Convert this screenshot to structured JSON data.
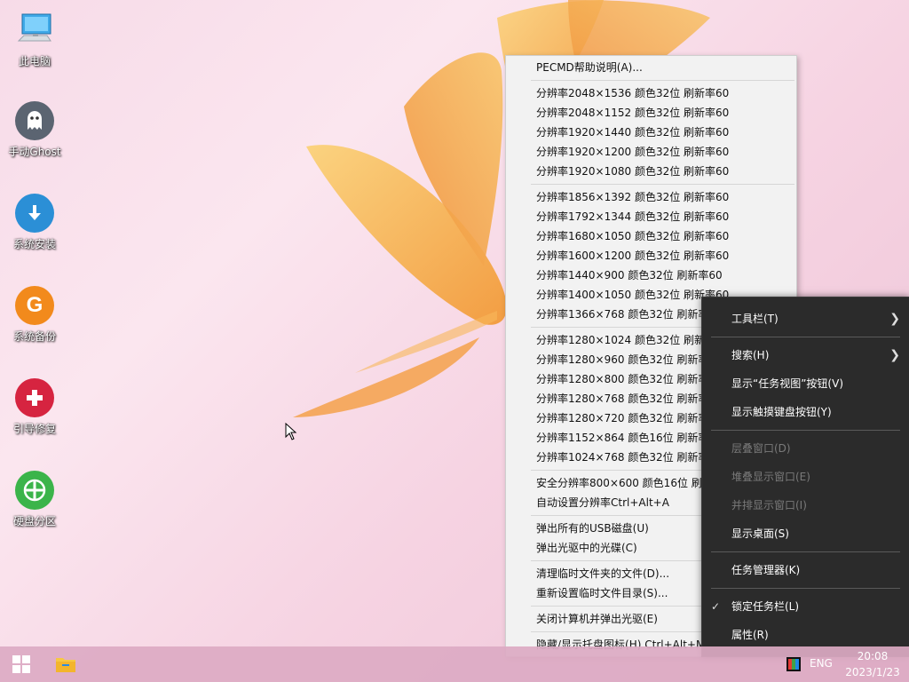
{
  "desktop_icons": [
    {
      "label": "此电脑",
      "icon": "computer-icon"
    },
    {
      "label": "手动Ghost",
      "icon": "ghost-icon"
    },
    {
      "label": "系统安装",
      "icon": "download-icon"
    },
    {
      "label": "系统备份",
      "icon": "g-backup-icon"
    },
    {
      "label": "引导修复",
      "icon": "plus-repair-icon"
    },
    {
      "label": "硬盘分区",
      "icon": "partition-icon"
    }
  ],
  "pecmd_menu": {
    "groups": [
      [
        "PECMD帮助说明(A)..."
      ],
      [
        "分辨率2048×1536 颜色32位 刷新率60",
        "分辨率2048×1152 颜色32位 刷新率60",
        "分辨率1920×1440 颜色32位 刷新率60",
        "分辨率1920×1200 颜色32位 刷新率60",
        "分辨率1920×1080 颜色32位 刷新率60"
      ],
      [
        "分辨率1856×1392 颜色32位 刷新率60",
        "分辨率1792×1344 颜色32位 刷新率60",
        "分辨率1680×1050 颜色32位 刷新率60",
        "分辨率1600×1200 颜色32位 刷新率60",
        "分辨率1440×900 颜色32位 刷新率60",
        "分辨率1400×1050 颜色32位 刷新率60",
        "分辨率1366×768 颜色32位 刷新率60"
      ],
      [
        "分辨率1280×1024 颜色32位 刷新率60",
        "分辨率1280×960 颜色32位 刷新率60",
        "分辨率1280×800 颜色32位 刷新率60",
        "分辨率1280×768 颜色32位 刷新率60",
        "分辨率1280×720 颜色32位 刷新率60",
        "分辨率1152×864 颜色16位 刷新率60",
        "分辨率1024×768 颜色32位 刷新率60"
      ],
      [
        "安全分辨率800×600  颜色16位 刷新率60",
        "自动设置分辨率Ctrl+Alt+A"
      ],
      [
        "弹出所有的USB磁盘(U)",
        "弹出光驱中的光碟(C)"
      ],
      [
        "清理临时文件夹的文件(D)...",
        "重新设置临时文件目录(S)..."
      ],
      [
        "关闭计算机并弹出光驱(E)"
      ],
      [
        "隐藏/显示托盘图标(H) Ctrl+Alt+M"
      ]
    ]
  },
  "taskbar_menu": {
    "groups": [
      [
        {
          "label": "工具栏(T)",
          "submenu": true
        }
      ],
      [
        {
          "label": "搜索(H)",
          "submenu": true
        },
        {
          "label": "显示“任务视图”按钮(V)"
        },
        {
          "label": "显示触摸键盘按钮(Y)"
        }
      ],
      [
        {
          "label": "层叠窗口(D)",
          "disabled": true
        },
        {
          "label": "堆叠显示窗口(E)",
          "disabled": true
        },
        {
          "label": "并排显示窗口(I)",
          "disabled": true
        },
        {
          "label": "显示桌面(S)"
        }
      ],
      [
        {
          "label": "任务管理器(K)"
        }
      ],
      [
        {
          "label": "锁定任务栏(L)",
          "checked": true
        },
        {
          "label": "属性(R)"
        }
      ]
    ]
  },
  "taskbar": {
    "start_icon": "windows-start-icon",
    "pinned": [
      {
        "icon": "file-explorer-icon"
      }
    ],
    "tray": {
      "app_icon": "color-display-icon",
      "language": "ENG",
      "time": "20:08",
      "date": "2023/1/23"
    }
  },
  "colors": {
    "menu_light_bg": "#f2f2f2",
    "menu_dark_bg": "#2b2b2b",
    "taskbar": "#dcaac3"
  }
}
